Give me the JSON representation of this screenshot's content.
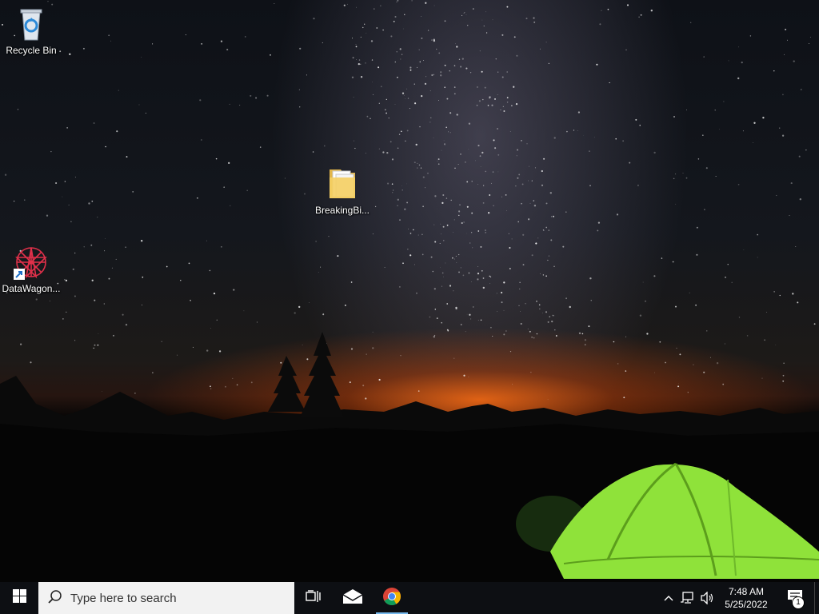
{
  "desktop": {
    "icons": [
      {
        "label": "Recycle Bin",
        "icon": "recycle-bin-icon"
      },
      {
        "label": "BreakingBi...",
        "icon": "folder-icon"
      },
      {
        "label": "DataWagon...",
        "icon": "datawagon-shortcut-icon"
      }
    ]
  },
  "taskbar": {
    "start_icon": "windows-logo-icon",
    "search": {
      "placeholder": "Type here to search",
      "icon": "search-icon"
    },
    "pinned": [
      {
        "name": "Task View",
        "icon": "task-view-icon"
      },
      {
        "name": "Mail",
        "icon": "mail-icon"
      },
      {
        "name": "Google Chrome",
        "icon": "chrome-icon",
        "active": true
      }
    ],
    "tray": {
      "icons": [
        "chevron-up-icon",
        "network-icon",
        "volume-icon"
      ],
      "time": "7:48 AM",
      "date": "5/25/2022",
      "notification_count": "1"
    }
  },
  "colors": {
    "taskbar": "#0d0f13",
    "search_bg": "#f2f2f2",
    "accent": "#76b9ed",
    "tent": "#8fe23a"
  }
}
